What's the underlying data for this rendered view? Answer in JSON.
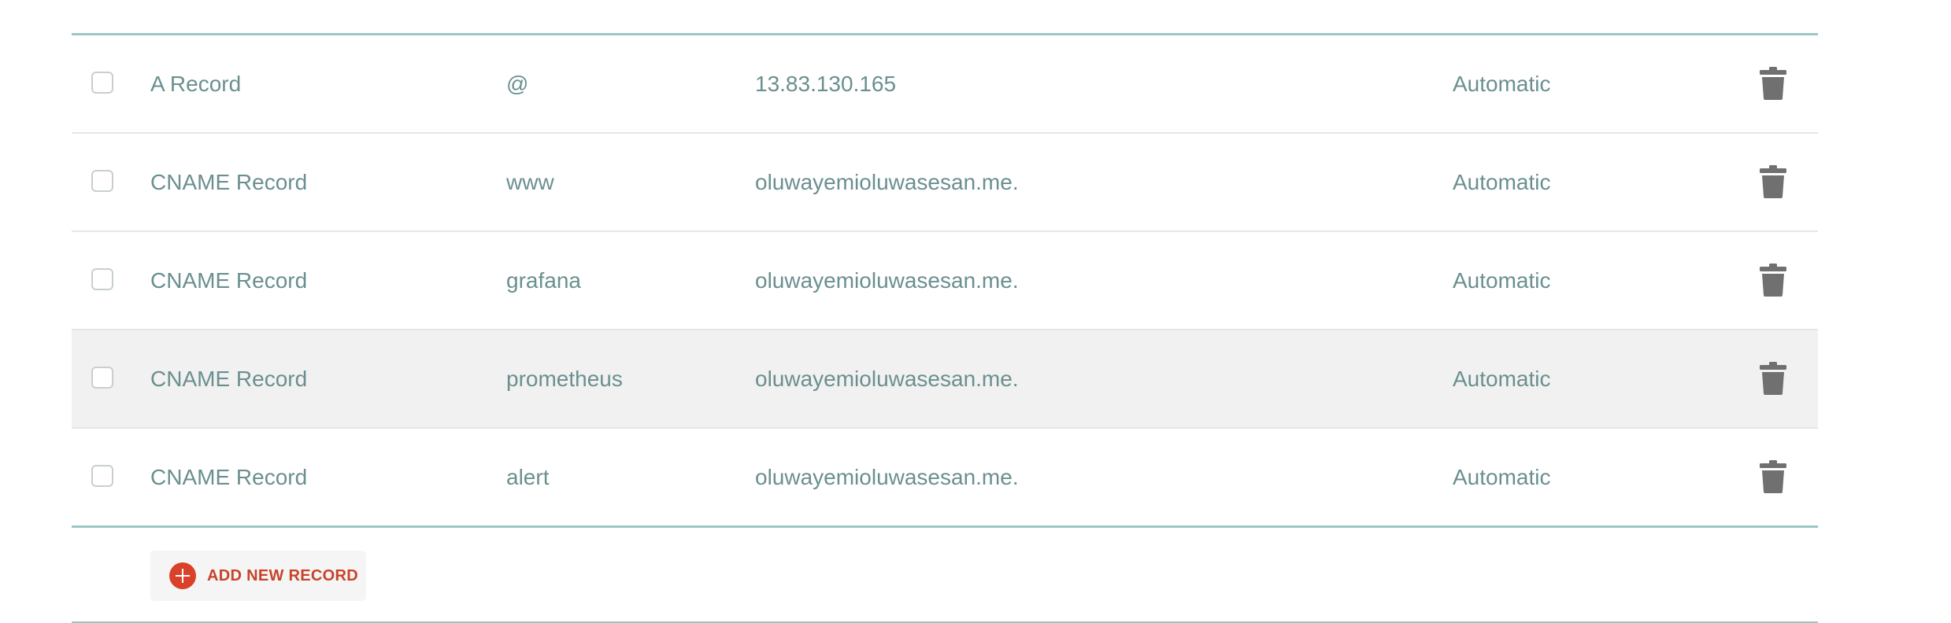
{
  "records": [
    {
      "type": "A Record",
      "host": "@",
      "value": "13.83.130.165",
      "ttl": "Automatic"
    },
    {
      "type": "CNAME Record",
      "host": "www",
      "value": "oluwayemioluwasesan.me.",
      "ttl": "Automatic"
    },
    {
      "type": "CNAME Record",
      "host": "grafana",
      "value": "oluwayemioluwasesan.me.",
      "ttl": "Automatic"
    },
    {
      "type": "CNAME Record",
      "host": "prometheus",
      "value": "oluwayemioluwasesan.me.",
      "ttl": "Automatic"
    },
    {
      "type": "CNAME Record",
      "host": "alert",
      "value": "oluwayemioluwasesan.me.",
      "ttl": "Automatic"
    }
  ],
  "add_button": {
    "label": "ADD NEW RECORD",
    "icon": "plus-circle-icon"
  },
  "row_icon": "trash-icon",
  "colors": {
    "accent_border": "#9bc6c6",
    "text": "#6b8f8f",
    "add_red": "#d9412b",
    "trash": "#707070",
    "hover_row": "#f1f1f1"
  }
}
